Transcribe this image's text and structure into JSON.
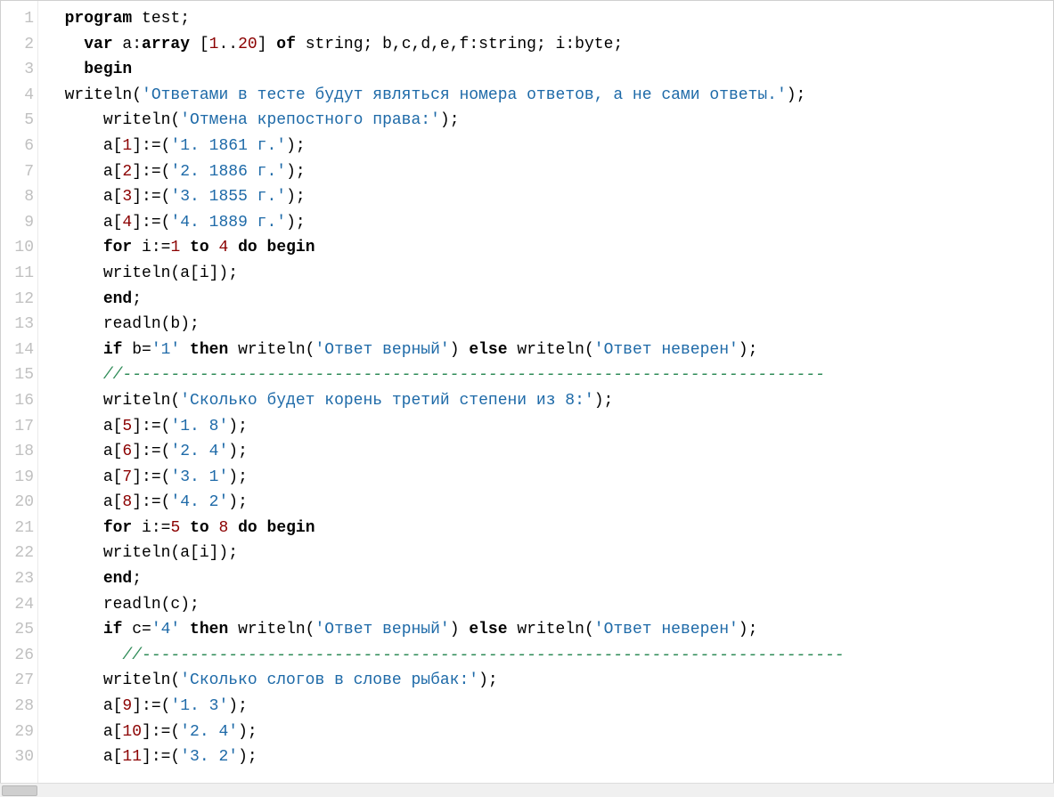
{
  "lines": [
    {
      "n": 1,
      "indent": 2,
      "tokens": [
        {
          "t": "kw",
          "v": "program"
        },
        {
          "t": "pln",
          "v": " test;"
        }
      ]
    },
    {
      "n": 2,
      "indent": 4,
      "tokens": [
        {
          "t": "kw",
          "v": "var"
        },
        {
          "t": "pln",
          "v": " a:"
        },
        {
          "t": "kw",
          "v": "array"
        },
        {
          "t": "pln",
          "v": " ["
        },
        {
          "t": "num",
          "v": "1"
        },
        {
          "t": "pln",
          "v": ".."
        },
        {
          "t": "num",
          "v": "20"
        },
        {
          "t": "pln",
          "v": "] "
        },
        {
          "t": "kw",
          "v": "of"
        },
        {
          "t": "pln",
          "v": " string; b,c,d,e,f:string; i:byte;"
        }
      ]
    },
    {
      "n": 3,
      "indent": 4,
      "tokens": [
        {
          "t": "kw",
          "v": "begin"
        }
      ]
    },
    {
      "n": 4,
      "indent": 2,
      "tokens": [
        {
          "t": "pln",
          "v": "writeln("
        },
        {
          "t": "str",
          "v": "'Ответами в тесте будут являться номера ответов, а не сами ответы.'"
        },
        {
          "t": "pln",
          "v": ");"
        }
      ]
    },
    {
      "n": 5,
      "indent": 6,
      "tokens": [
        {
          "t": "pln",
          "v": "writeln("
        },
        {
          "t": "str",
          "v": "'Отмена крепостного права:'"
        },
        {
          "t": "pln",
          "v": ");"
        }
      ]
    },
    {
      "n": 6,
      "indent": 6,
      "tokens": [
        {
          "t": "pln",
          "v": "a["
        },
        {
          "t": "num",
          "v": "1"
        },
        {
          "t": "pln",
          "v": "]:=("
        },
        {
          "t": "str",
          "v": "'1. 1861 г.'"
        },
        {
          "t": "pln",
          "v": ");"
        }
      ]
    },
    {
      "n": 7,
      "indent": 6,
      "tokens": [
        {
          "t": "pln",
          "v": "a["
        },
        {
          "t": "num",
          "v": "2"
        },
        {
          "t": "pln",
          "v": "]:=("
        },
        {
          "t": "str",
          "v": "'2. 1886 г.'"
        },
        {
          "t": "pln",
          "v": ");"
        }
      ]
    },
    {
      "n": 8,
      "indent": 6,
      "tokens": [
        {
          "t": "pln",
          "v": "a["
        },
        {
          "t": "num",
          "v": "3"
        },
        {
          "t": "pln",
          "v": "]:=("
        },
        {
          "t": "str",
          "v": "'3. 1855 г.'"
        },
        {
          "t": "pln",
          "v": ");"
        }
      ]
    },
    {
      "n": 9,
      "indent": 6,
      "tokens": [
        {
          "t": "pln",
          "v": "a["
        },
        {
          "t": "num",
          "v": "4"
        },
        {
          "t": "pln",
          "v": "]:=("
        },
        {
          "t": "str",
          "v": "'4. 1889 г.'"
        },
        {
          "t": "pln",
          "v": ");"
        }
      ]
    },
    {
      "n": 10,
      "indent": 6,
      "tokens": [
        {
          "t": "kw",
          "v": "for"
        },
        {
          "t": "pln",
          "v": " i:="
        },
        {
          "t": "num",
          "v": "1"
        },
        {
          "t": "pln",
          "v": " "
        },
        {
          "t": "kw",
          "v": "to"
        },
        {
          "t": "pln",
          "v": " "
        },
        {
          "t": "num",
          "v": "4"
        },
        {
          "t": "pln",
          "v": " "
        },
        {
          "t": "kw",
          "v": "do"
        },
        {
          "t": "pln",
          "v": " "
        },
        {
          "t": "kw",
          "v": "begin"
        }
      ]
    },
    {
      "n": 11,
      "indent": 6,
      "tokens": [
        {
          "t": "pln",
          "v": "writeln(a[i]);"
        }
      ]
    },
    {
      "n": 12,
      "indent": 6,
      "tokens": [
        {
          "t": "kw",
          "v": "end"
        },
        {
          "t": "pln",
          "v": ";"
        }
      ]
    },
    {
      "n": 13,
      "indent": 6,
      "tokens": [
        {
          "t": "pln",
          "v": "readln(b);"
        }
      ]
    },
    {
      "n": 14,
      "indent": 6,
      "tokens": [
        {
          "t": "kw",
          "v": "if"
        },
        {
          "t": "pln",
          "v": " b="
        },
        {
          "t": "str",
          "v": "'1'"
        },
        {
          "t": "pln",
          "v": " "
        },
        {
          "t": "kw",
          "v": "then"
        },
        {
          "t": "pln",
          "v": " writeln("
        },
        {
          "t": "str",
          "v": "'Ответ верный'"
        },
        {
          "t": "pln",
          "v": ") "
        },
        {
          "t": "kw",
          "v": "else"
        },
        {
          "t": "pln",
          "v": " writeln("
        },
        {
          "t": "str",
          "v": "'Ответ неверен'"
        },
        {
          "t": "pln",
          "v": ");"
        }
      ]
    },
    {
      "n": 15,
      "indent": 6,
      "tokens": [
        {
          "t": "cmt",
          "v": "//-------------------------------------------------------------------------"
        }
      ]
    },
    {
      "n": 16,
      "indent": 6,
      "tokens": [
        {
          "t": "pln",
          "v": "writeln("
        },
        {
          "t": "str",
          "v": "'Сколько будет корень третий степени из 8:'"
        },
        {
          "t": "pln",
          "v": ");"
        }
      ]
    },
    {
      "n": 17,
      "indent": 6,
      "tokens": [
        {
          "t": "pln",
          "v": "a["
        },
        {
          "t": "num",
          "v": "5"
        },
        {
          "t": "pln",
          "v": "]:=("
        },
        {
          "t": "str",
          "v": "'1. 8'"
        },
        {
          "t": "pln",
          "v": ");"
        }
      ]
    },
    {
      "n": 18,
      "indent": 6,
      "tokens": [
        {
          "t": "pln",
          "v": "a["
        },
        {
          "t": "num",
          "v": "6"
        },
        {
          "t": "pln",
          "v": "]:=("
        },
        {
          "t": "str",
          "v": "'2. 4'"
        },
        {
          "t": "pln",
          "v": ");"
        }
      ]
    },
    {
      "n": 19,
      "indent": 6,
      "tokens": [
        {
          "t": "pln",
          "v": "a["
        },
        {
          "t": "num",
          "v": "7"
        },
        {
          "t": "pln",
          "v": "]:=("
        },
        {
          "t": "str",
          "v": "'3. 1'"
        },
        {
          "t": "pln",
          "v": ");"
        }
      ]
    },
    {
      "n": 20,
      "indent": 6,
      "tokens": [
        {
          "t": "pln",
          "v": "a["
        },
        {
          "t": "num",
          "v": "8"
        },
        {
          "t": "pln",
          "v": "]:=("
        },
        {
          "t": "str",
          "v": "'4. 2'"
        },
        {
          "t": "pln",
          "v": ");"
        }
      ]
    },
    {
      "n": 21,
      "indent": 6,
      "tokens": [
        {
          "t": "kw",
          "v": "for"
        },
        {
          "t": "pln",
          "v": " i:="
        },
        {
          "t": "num",
          "v": "5"
        },
        {
          "t": "pln",
          "v": " "
        },
        {
          "t": "kw",
          "v": "to"
        },
        {
          "t": "pln",
          "v": " "
        },
        {
          "t": "num",
          "v": "8"
        },
        {
          "t": "pln",
          "v": " "
        },
        {
          "t": "kw",
          "v": "do"
        },
        {
          "t": "pln",
          "v": " "
        },
        {
          "t": "kw",
          "v": "begin"
        }
      ]
    },
    {
      "n": 22,
      "indent": 6,
      "tokens": [
        {
          "t": "pln",
          "v": "writeln(a[i]);"
        }
      ]
    },
    {
      "n": 23,
      "indent": 6,
      "tokens": [
        {
          "t": "kw",
          "v": "end"
        },
        {
          "t": "pln",
          "v": ";"
        }
      ]
    },
    {
      "n": 24,
      "indent": 6,
      "tokens": [
        {
          "t": "pln",
          "v": "readln(c);"
        }
      ]
    },
    {
      "n": 25,
      "indent": 6,
      "tokens": [
        {
          "t": "kw",
          "v": "if"
        },
        {
          "t": "pln",
          "v": " c="
        },
        {
          "t": "str",
          "v": "'4'"
        },
        {
          "t": "pln",
          "v": " "
        },
        {
          "t": "kw",
          "v": "then"
        },
        {
          "t": "pln",
          "v": " writeln("
        },
        {
          "t": "str",
          "v": "'Ответ верный'"
        },
        {
          "t": "pln",
          "v": ") "
        },
        {
          "t": "kw",
          "v": "else"
        },
        {
          "t": "pln",
          "v": " writeln("
        },
        {
          "t": "str",
          "v": "'Ответ неверен'"
        },
        {
          "t": "pln",
          "v": ");"
        }
      ]
    },
    {
      "n": 26,
      "indent": 8,
      "tokens": [
        {
          "t": "cmt",
          "v": "//-------------------------------------------------------------------------"
        }
      ]
    },
    {
      "n": 27,
      "indent": 6,
      "tokens": [
        {
          "t": "pln",
          "v": "writeln("
        },
        {
          "t": "str",
          "v": "'Сколько слогов в слове рыбак:'"
        },
        {
          "t": "pln",
          "v": ");"
        }
      ]
    },
    {
      "n": 28,
      "indent": 6,
      "tokens": [
        {
          "t": "pln",
          "v": "a["
        },
        {
          "t": "num",
          "v": "9"
        },
        {
          "t": "pln",
          "v": "]:=("
        },
        {
          "t": "str",
          "v": "'1. 3'"
        },
        {
          "t": "pln",
          "v": ");"
        }
      ]
    },
    {
      "n": 29,
      "indent": 6,
      "tokens": [
        {
          "t": "pln",
          "v": "a["
        },
        {
          "t": "num",
          "v": "10"
        },
        {
          "t": "pln",
          "v": "]:=("
        },
        {
          "t": "str",
          "v": "'2. 4'"
        },
        {
          "t": "pln",
          "v": ");"
        }
      ]
    },
    {
      "n": 30,
      "indent": 6,
      "tokens": [
        {
          "t": "pln",
          "v": "a["
        },
        {
          "t": "num",
          "v": "11"
        },
        {
          "t": "pln",
          "v": "]:=("
        },
        {
          "t": "str",
          "v": "'3. 2'"
        },
        {
          "t": "pln",
          "v": ");"
        }
      ]
    }
  ]
}
